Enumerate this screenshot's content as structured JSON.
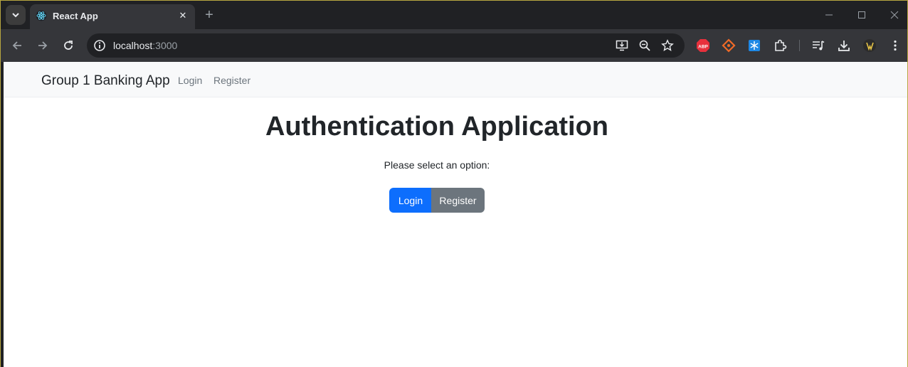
{
  "browser": {
    "tab": {
      "title": "React App",
      "favicon": "react-icon"
    },
    "url": {
      "host": "localhost",
      "port": ":3000"
    },
    "icons": {
      "tab_search": "chevron-down-icon",
      "new_tab": "+",
      "close": "✕"
    }
  },
  "navbar": {
    "brand": "Group 1 Banking App",
    "links": [
      {
        "label": "Login"
      },
      {
        "label": "Register"
      }
    ]
  },
  "main": {
    "title": "Authentication Application",
    "prompt": "Please select an option:",
    "buttons": {
      "login": "Login",
      "register": "Register"
    }
  },
  "colors": {
    "primary": "#0d6efd",
    "secondary": "#6c757d",
    "navbar_bg": "#f8f9fa"
  }
}
